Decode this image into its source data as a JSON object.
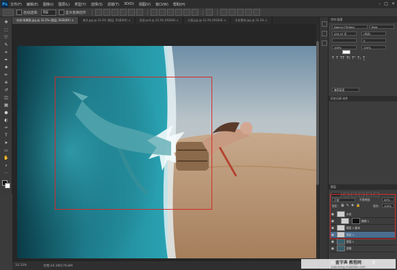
{
  "menu": {
    "logo": "Ps",
    "items": [
      "文件(F)",
      "编辑(E)",
      "图像(I)",
      "图层(L)",
      "类型(Y)",
      "选择(S)",
      "滤镜(T)",
      "3D(D)",
      "视图(V)",
      "窗口(W)",
      "帮助(H)"
    ],
    "window_controls": [
      "–",
      "□",
      "✕"
    ]
  },
  "options": {
    "auto_select_label": "自动选择:",
    "auto_select_value": "图层",
    "transform_label": "显示变换控件"
  },
  "tabs": [
    {
      "label": "合成-效果图.jpg @ 33.3% (图层, RGB/8#) ×"
    },
    {
      "label": "海洋.jpg @ 33.3% (图层, RGB/8#) ×"
    },
    {
      "label": "女孩.psd @ 33.3% (RGB/8) ×"
    },
    {
      "label": "沙漠.jpg @ 33.3% (RGB/8) ×"
    },
    {
      "label": "水花素材.jpg @ 33.3% ×"
    }
  ],
  "status": {
    "zoom": "33.33%",
    "doc": "文档:24.1M/179.8M"
  },
  "character": {
    "tabs": "字符  段落",
    "font": "Agency FB Bold",
    "style": "Bold",
    "size": "430.47 点",
    "leading": "(自动)",
    "kerning": "0",
    "scale_v": "100%",
    "scale_h": "100%",
    "language": "美国英语"
  },
  "history_tabs": "历史记录  动作",
  "layers": {
    "tabs": "图层",
    "blend_mode": "正常",
    "opacity_label": "不透明度:",
    "opacity": "40%",
    "lock_label": "锁定:",
    "fill_label": "填充:",
    "fill": "100%",
    "rows": [
      {
        "name": "水花"
      },
      {
        "name": "曲线 1"
      },
      {
        "name": "图层 2 副本"
      },
      {
        "name": "图层 2"
      },
      {
        "name": "图层 1"
      },
      {
        "name": "背景"
      }
    ]
  },
  "watermark": {
    "site": "jiaocheng.chazidian.com",
    "brand": "查字典 教程网"
  }
}
